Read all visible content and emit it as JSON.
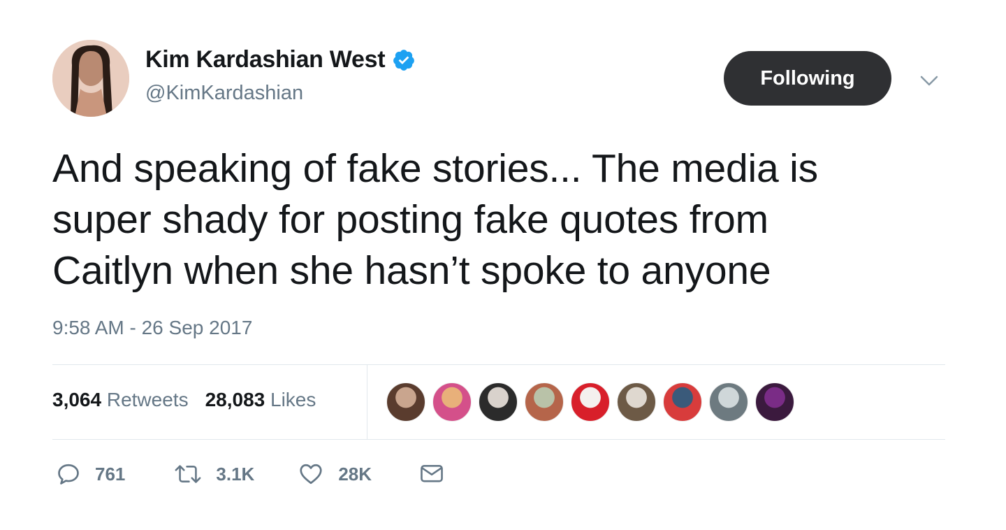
{
  "user": {
    "display_name": "Kim Kardashian West",
    "handle": "@KimKardashian"
  },
  "follow_button": {
    "label": "Following"
  },
  "tweet": {
    "text": "And speaking of fake stories... The media is\nsuper shady for posting fake  quotes from\nCaitlyn when she hasn’t spoke to anyone",
    "timestamp": "9:58 AM - 26 Sep 2017"
  },
  "stats": {
    "retweets_count": "3,064",
    "retweets_label": "Retweets",
    "likes_count": "28,083",
    "likes_label": "Likes"
  },
  "likers": [
    {
      "colors": [
        "#c9a58e",
        "#5a3c2e"
      ]
    },
    {
      "colors": [
        "#e8b07a",
        "#d4508a"
      ]
    },
    {
      "colors": [
        "#d9d2cc",
        "#2b2b2b"
      ]
    },
    {
      "colors": [
        "#b9c2a8",
        "#b5654a"
      ]
    },
    {
      "colors": [
        "#f4f0ee",
        "#d81f2a"
      ]
    },
    {
      "colors": [
        "#dfd8cf",
        "#6d5a46"
      ]
    },
    {
      "colors": [
        "#3a5a7a",
        "#d83c3c"
      ]
    },
    {
      "colors": [
        "#cfd7d9",
        "#6d7a80"
      ]
    },
    {
      "colors": [
        "#7a2c86",
        "#3b1a3e"
      ]
    }
  ],
  "actions": {
    "reply": {
      "icon": "reply-icon",
      "count": "761"
    },
    "retweet": {
      "icon": "retweet-icon",
      "count": "3.1K"
    },
    "like": {
      "icon": "heart-icon",
      "count": "28K"
    },
    "message": {
      "icon": "envelope-icon"
    }
  },
  "colors": {
    "verified_blue": "#1da1f2",
    "text_primary": "#14171a",
    "text_secondary": "#657786",
    "button_dark": "#2f3033",
    "divider": "#e1e8ed"
  }
}
